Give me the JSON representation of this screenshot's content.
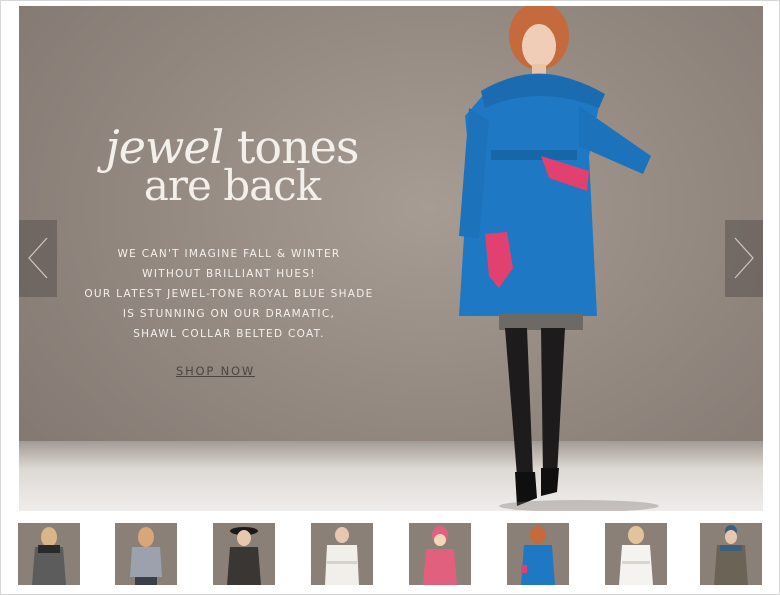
{
  "hero": {
    "headline_italic": "jewel",
    "headline_rest": " tones",
    "headline_line2": "are back",
    "body_lines": [
      "WE CAN'T IMAGINE FALL & WINTER",
      "WITHOUT BRILLIANT HUES!",
      "OUR LATEST JEWEL-TONE ROYAL BLUE SHADE",
      "IS STUNNING ON OUR DRAMATIC,",
      "SHAWL COLLAR BELTED COAT."
    ],
    "cta_label": "SHOP NOW"
  },
  "carousel": {
    "prev_icon": "chevron-left-icon",
    "next_icon": "chevron-right-icon"
  },
  "colors": {
    "coat_blue": "#1f78c4",
    "gloves_pink": "#e2406e",
    "backdrop": "#958a82"
  },
  "thumbnails": [
    {
      "coat": "#5c5c5c",
      "accent": "#2a2a2a"
    },
    {
      "coat": "#9ba2ad",
      "accent": "#3b3f47"
    },
    {
      "coat": "#3a3633",
      "accent": "#1a1a1a"
    },
    {
      "coat": "#f1efea",
      "accent": "#d6d3cc"
    },
    {
      "coat": "#e0607e",
      "accent": "#f2d7b8"
    },
    {
      "coat": "#1f78c4",
      "accent": "#e2406e"
    },
    {
      "coat": "#f4f3ef",
      "accent": "#d9d6ce"
    },
    {
      "coat": "#6b6456",
      "accent": "#3c5f7a"
    }
  ]
}
